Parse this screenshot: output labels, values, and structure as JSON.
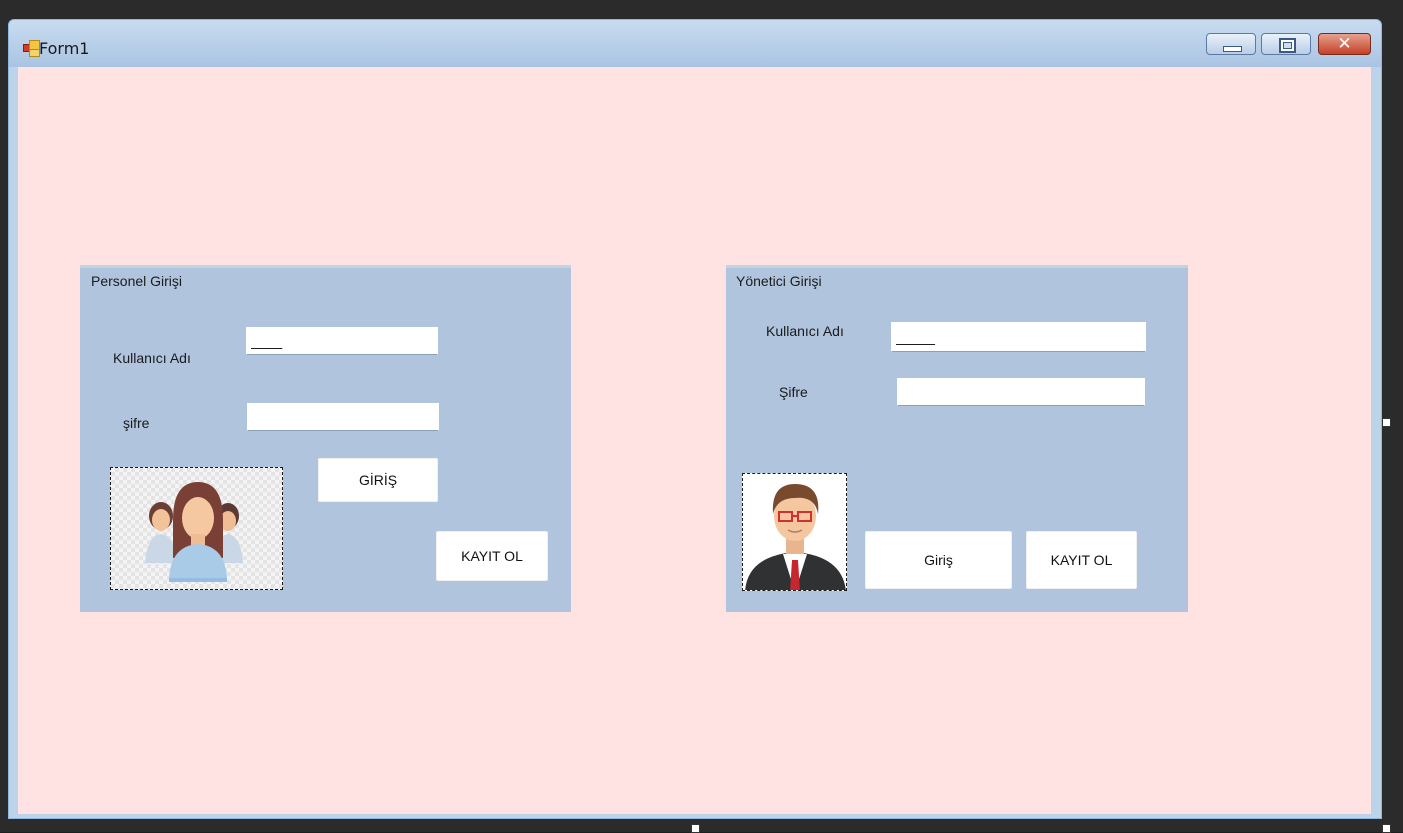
{
  "window": {
    "title": "Form1"
  },
  "personel_group": {
    "title": "Personel Girişi",
    "username_label": "Kullanıcı Adı",
    "username_value": "____",
    "password_label": "şifre",
    "password_value": "",
    "login_button": "GİRİŞ",
    "register_button": "KAYIT OL",
    "picture_icon": "group-of-people-icon"
  },
  "yonetici_group": {
    "title": "Yönetici Girişi",
    "username_label": "Kullanıcı Adı",
    "username_value": "_____",
    "password_label": "Şifre",
    "password_value": "",
    "login_button": "Giriş",
    "register_button": "KAYIT OL",
    "picture_icon": "businessman-avatar-icon"
  },
  "colors": {
    "form_background": "#ffe3e3",
    "groupbox_background": "#b0c4de",
    "titlebar": "#b9cfe8",
    "close_button": "#c5412a"
  }
}
